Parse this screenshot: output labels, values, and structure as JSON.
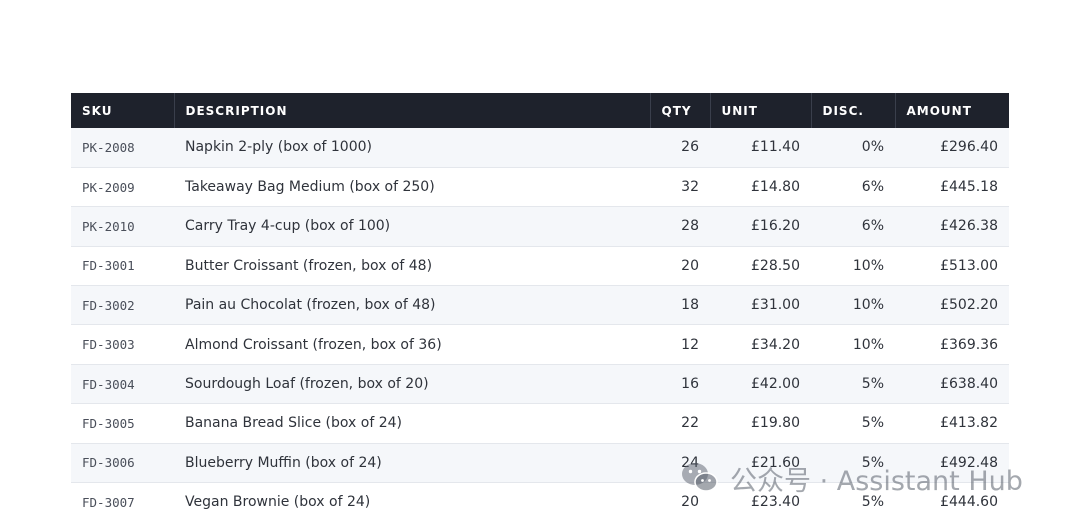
{
  "table": {
    "headers": {
      "sku": "SKU",
      "description": "DESCRIPTION",
      "qty": "QTY",
      "unit": "UNIT",
      "disc": "DISC.",
      "amount": "AMOUNT"
    },
    "rows": [
      {
        "sku": "PK-2008",
        "description": "Napkin 2-ply (box of 1000)",
        "qty": "26",
        "unit": "£11.40",
        "disc": "0%",
        "amount": "£296.40"
      },
      {
        "sku": "PK-2009",
        "description": "Takeaway Bag Medium (box of 250)",
        "qty": "32",
        "unit": "£14.80",
        "disc": "6%",
        "amount": "£445.18"
      },
      {
        "sku": "PK-2010",
        "description": "Carry Tray 4-cup (box of 100)",
        "qty": "28",
        "unit": "£16.20",
        "disc": "6%",
        "amount": "£426.38"
      },
      {
        "sku": "FD-3001",
        "description": "Butter Croissant (frozen, box of 48)",
        "qty": "20",
        "unit": "£28.50",
        "disc": "10%",
        "amount": "£513.00"
      },
      {
        "sku": "FD-3002",
        "description": "Pain au Chocolat (frozen, box of 48)",
        "qty": "18",
        "unit": "£31.00",
        "disc": "10%",
        "amount": "£502.20"
      },
      {
        "sku": "FD-3003",
        "description": "Almond Croissant (frozen, box of 36)",
        "qty": "12",
        "unit": "£34.20",
        "disc": "10%",
        "amount": "£369.36"
      },
      {
        "sku": "FD-3004",
        "description": "Sourdough Loaf (frozen, box of 20)",
        "qty": "16",
        "unit": "£42.00",
        "disc": "5%",
        "amount": "£638.40"
      },
      {
        "sku": "FD-3005",
        "description": "Banana Bread Slice (box of 24)",
        "qty": "22",
        "unit": "£19.80",
        "disc": "5%",
        "amount": "£413.82"
      },
      {
        "sku": "FD-3006",
        "description": "Blueberry Muffin (box of 24)",
        "qty": "24",
        "unit": "£21.60",
        "disc": "5%",
        "amount": "£492.48"
      },
      {
        "sku": "FD-3007",
        "description": "Vegan Brownie (box of 24)",
        "qty": "20",
        "unit": "£23.40",
        "disc": "5%",
        "amount": "£444.60"
      }
    ]
  },
  "watermark": {
    "text": "公众号 · Assistant Hub",
    "icon": "wechat-logo-icon"
  },
  "colors": {
    "header_bg": "#1e222c",
    "row_alt_bg": "#f5f7fa",
    "border": "#e4e7ec"
  }
}
